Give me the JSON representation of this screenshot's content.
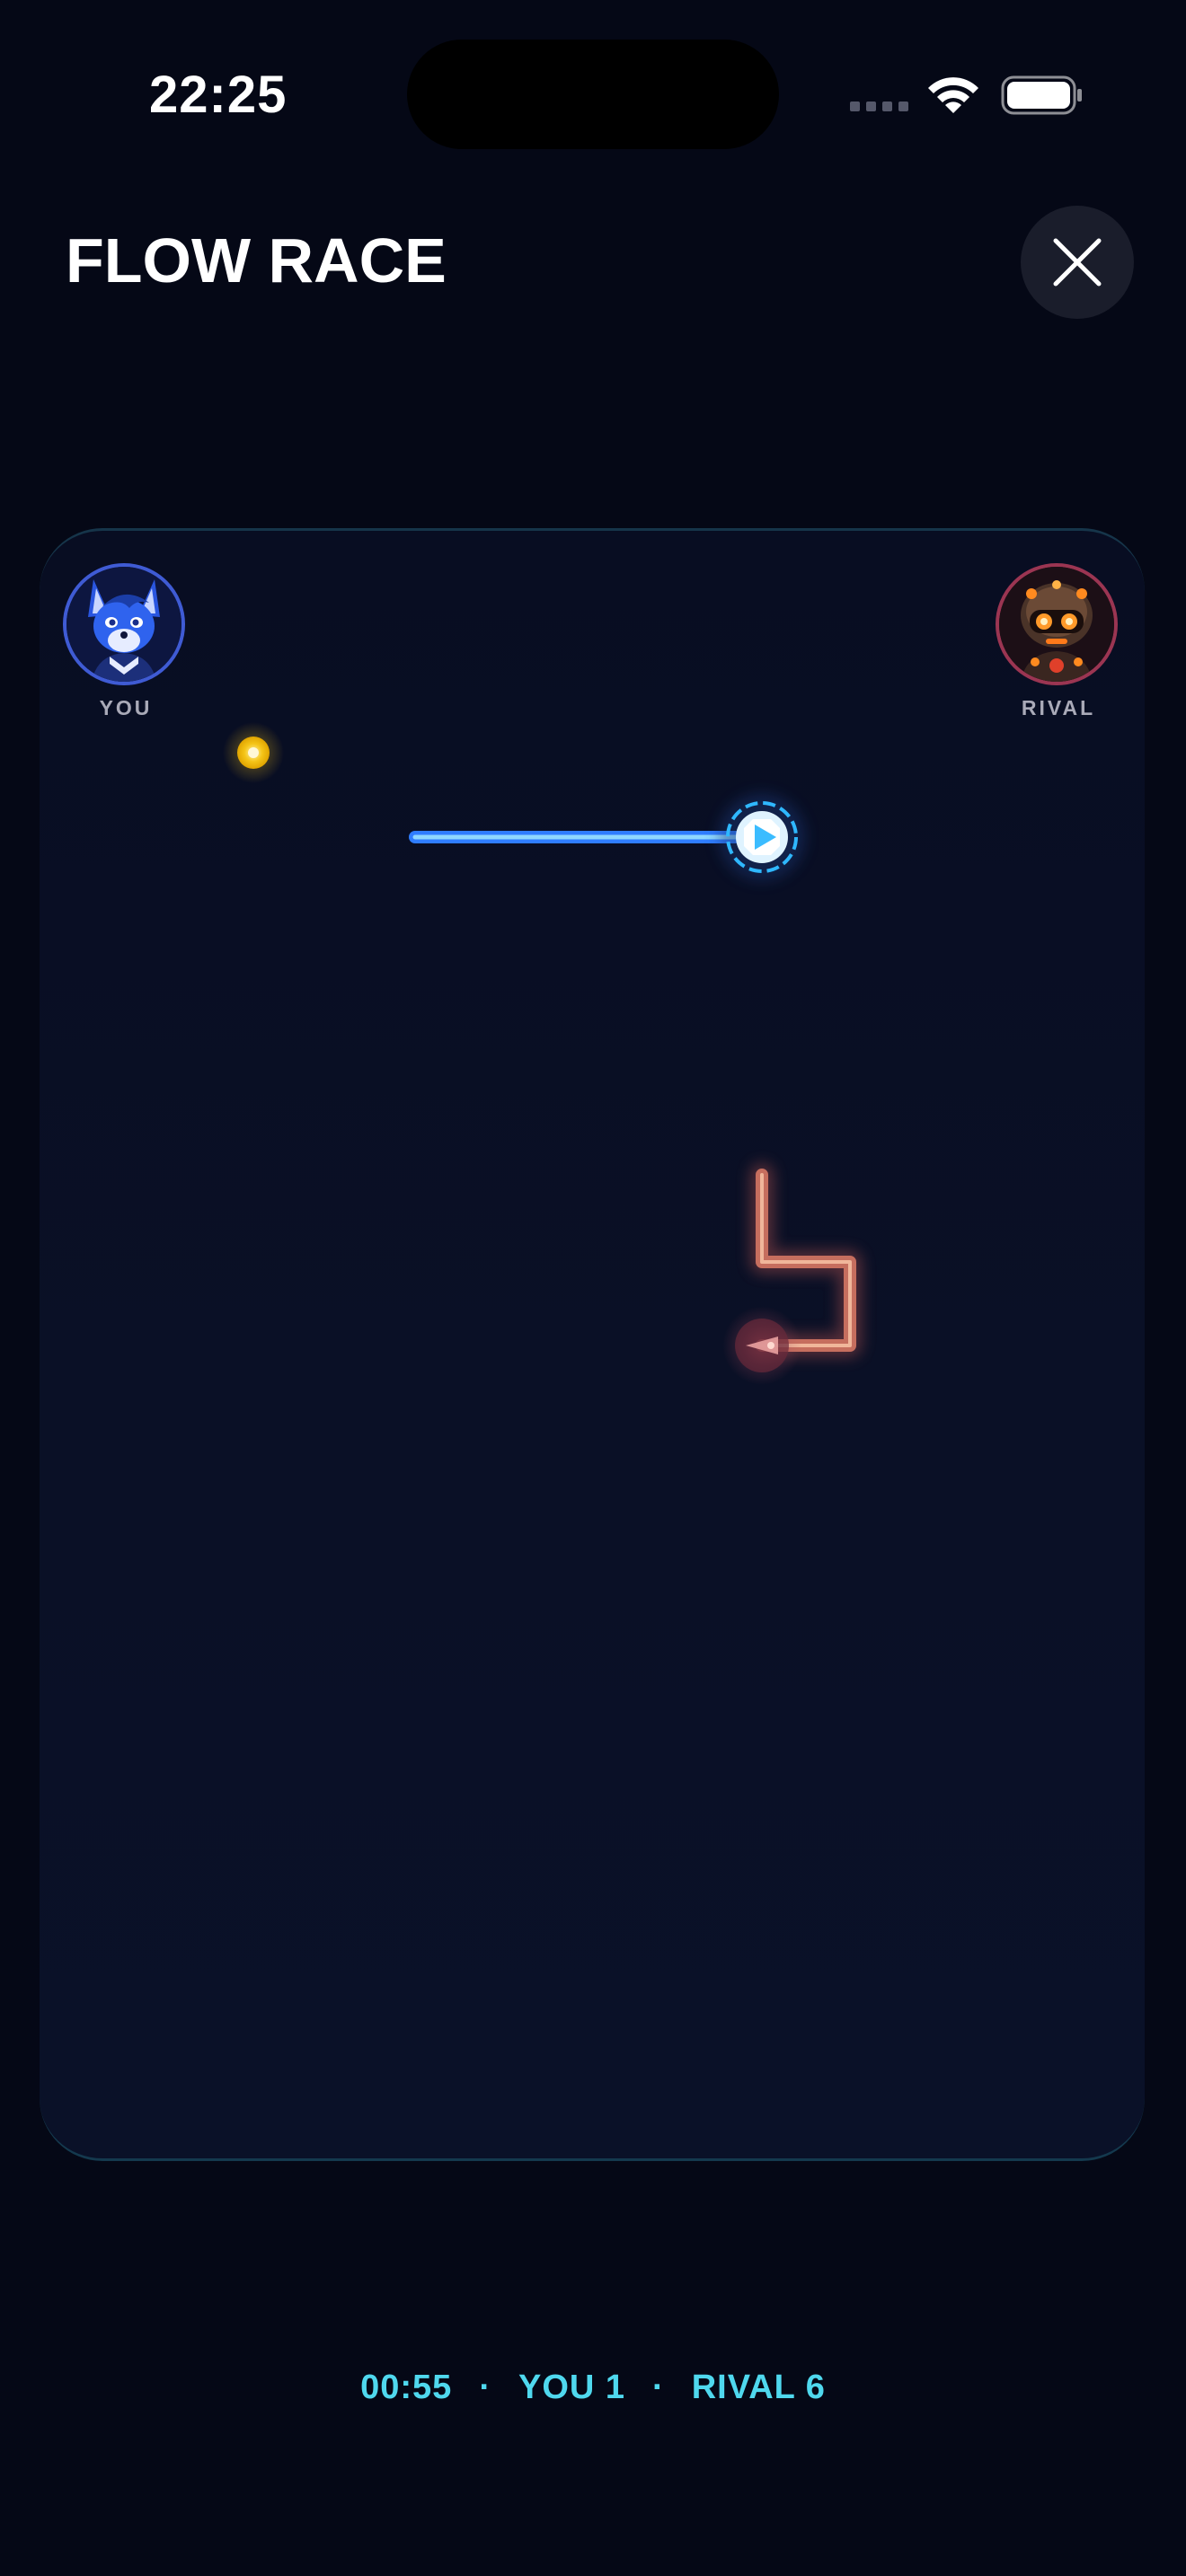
{
  "status_bar": {
    "time": "22:25"
  },
  "header": {
    "title": "FLOW RACE",
    "close_icon": "close-icon"
  },
  "players": {
    "you": {
      "label": "YOU",
      "avatar": "blue-fox-avatar",
      "ring_color": "#3f5bd4"
    },
    "rival": {
      "label": "RIVAL",
      "avatar": "robot-avatar",
      "ring_color": "#9b3552"
    }
  },
  "board": {
    "pickup": {
      "icon": "yellow-orb-icon",
      "color": "#f5c518"
    },
    "you_trail": {
      "color": "#3aa0ff",
      "head_icon": "player-head-arrow-icon"
    },
    "rival_trail": {
      "color": "#d88a73",
      "head_icon": "rival-head-arrow-icon"
    }
  },
  "footer": {
    "timer": "00:55",
    "separator": "·",
    "you_score": "YOU 1",
    "rival_score": "RIVAL 6"
  },
  "colors": {
    "background": "#050816",
    "board": "#0a1026",
    "accent_cyan": "#4fd8ee"
  }
}
